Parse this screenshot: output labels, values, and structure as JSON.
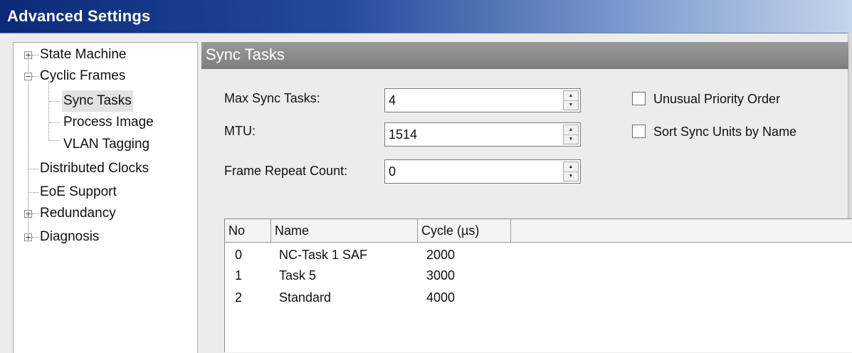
{
  "window": {
    "title": "Advanced Settings"
  },
  "tree": {
    "items": [
      {
        "label": "State Machine",
        "expander": "+"
      },
      {
        "label": "Cyclic Frames",
        "expander": "−"
      },
      {
        "label": "Sync Tasks"
      },
      {
        "label": "Process Image"
      },
      {
        "label": "VLAN Tagging"
      },
      {
        "label": "Distributed Clocks"
      },
      {
        "label": "EoE Support"
      },
      {
        "label": "Redundancy",
        "expander": "+"
      },
      {
        "label": "Diagnosis",
        "expander": "+"
      }
    ],
    "selected": "Sync Tasks"
  },
  "pane": {
    "title": "Sync Tasks"
  },
  "fields": {
    "max_sync_tasks": {
      "label": "Max Sync Tasks:",
      "value": "4"
    },
    "mtu": {
      "label": "MTU:",
      "value": "1514"
    },
    "frame_repeat_count": {
      "label": "Frame Repeat Count:",
      "value": "0"
    }
  },
  "checkboxes": {
    "unusual_priority_order": {
      "label": "Unusual Priority Order",
      "checked": false
    },
    "sort_sync_units": {
      "label": "Sort Sync Units by Name",
      "checked": false
    }
  },
  "list": {
    "columns": [
      "No",
      "Name",
      "Cycle (µs)"
    ],
    "rows": [
      [
        "0",
        "NC-Task 1 SAF",
        "2000"
      ],
      [
        "1",
        "Task 5",
        "3000"
      ],
      [
        "2",
        "Standard",
        "4000"
      ]
    ]
  }
}
